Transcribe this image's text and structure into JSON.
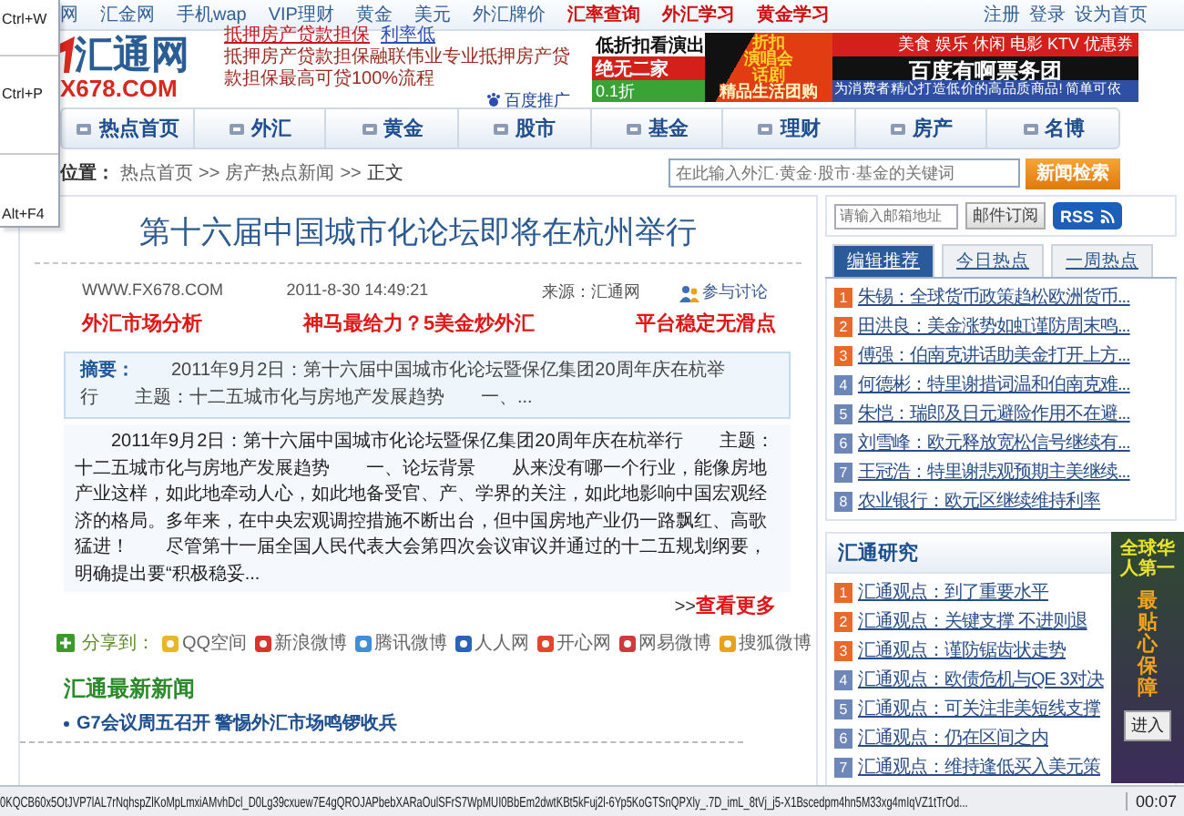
{
  "context_menu": {
    "items": [
      "Ctrl+W",
      "Ctrl+P",
      "Alt+F4"
    ]
  },
  "top_links": [
    {
      "text": "网",
      "kind": "plain"
    },
    {
      "text": "汇金网",
      "kind": "plain"
    },
    {
      "text": "手机wap",
      "kind": "plain"
    },
    {
      "text": "VIP理财",
      "kind": "plain"
    },
    {
      "text": "黄金",
      "kind": "plain"
    },
    {
      "text": "美元",
      "kind": "plain"
    },
    {
      "text": "外汇牌价",
      "kind": "plain"
    },
    {
      "text": "汇率查询",
      "kind": "hot"
    },
    {
      "text": "外汇学习",
      "kind": "hot"
    },
    {
      "text": "黄金学习",
      "kind": "hot"
    }
  ],
  "account_links": [
    "注册",
    "登录",
    "设为首页"
  ],
  "logo": {
    "name": "汇通网",
    "domain": "X678.COM"
  },
  "text_ad": {
    "headline": [
      "抵押房产贷款担保",
      "利率低"
    ],
    "body": "抵押房产贷款担保融联伟业专业抵押房产贷款担保最高可贷100%流程",
    "sponsor": "百度推广"
  },
  "banner_ad": {
    "tagline": "低折扣看演出",
    "badge": "绝无二家",
    "discount": "0.1折",
    "promo": [
      "折扣",
      "演唱会",
      "话剧"
    ],
    "offer": "精品生活团购",
    "categories": "美食 娱乐 休闲 电影 KTV 优惠券",
    "brand": "百度有啊票务团",
    "slogan": "为消费者精心打造低价的高品质商品! 简单可依"
  },
  "nav": [
    {
      "label": "热点首页"
    },
    {
      "label": "外汇"
    },
    {
      "label": "黄金"
    },
    {
      "label": "股市"
    },
    {
      "label": "基金"
    },
    {
      "label": "理财"
    },
    {
      "label": "房产"
    },
    {
      "label": "名博"
    }
  ],
  "breadcrumb": {
    "label": "位置：",
    "items": [
      {
        "kind": "link",
        "text": "热点首页"
      },
      {
        "kind": "sep",
        "text": ">>"
      },
      {
        "kind": "link",
        "text": "房产热点新闻"
      },
      {
        "kind": "sep",
        "text": ">>"
      },
      {
        "kind": "current",
        "text": "正文"
      }
    ]
  },
  "search": {
    "placeholder": "在此输入外汇·黄金·股市·基金的关键词",
    "button": "新闻检索"
  },
  "subscribe": {
    "placeholder": "请输入邮箱地址",
    "button": "邮件订阅",
    "rss": "RSS"
  },
  "article": {
    "title": "第十六届中国城市化论坛即将在杭州举行",
    "site": "WWW.FX678.COM",
    "date": "2011-8-30 14:49:21",
    "source": "来源：汇通网",
    "discuss": "参与讨论",
    "promo_links": [
      "外汇市场分析",
      "神马最给力？5美金炒外汇",
      "平台稳定无滑点"
    ],
    "summary_label": "摘要：",
    "summary": "2011年9月2日：第十六届中国城市化论坛暨保亿集团20周年庆在杭举行　　主题：十二五城市化与房地产发展趋势　　一、...",
    "body": "　　2011年9月2日：第十六届中国城市化论坛暨保亿集团20周年庆在杭举行　　主题：十二五城市化与房地产发展趋势　　一、论坛背景　　从来没有哪一个行业，能像房地产业这样，如此地牵动人心，如此地备受官、产、学界的关注，如此地影响中国宏观经济的格局。多年来，在中央宏观调控措施不断出台，但中国房地产业仍一路飘红、高歌猛进！　　尽管第十一届全国人民代表大会第四次会议审议并通过的十二五规划纲要，明确提出要“积极稳妥...",
    "more_prefix": ">>",
    "more": "查看更多"
  },
  "share": {
    "label": "分享到：",
    "targets": [
      "QQ空间",
      "新浪微博",
      "腾讯微博",
      "人人网",
      "开心网",
      "网易微博",
      "搜狐微博"
    ]
  },
  "latest_news": {
    "title": "汇通最新新闻",
    "items": [
      "G7会议周五召开  警惕外汇市场鸣锣收兵"
    ]
  },
  "tabs": [
    {
      "label": "编辑推荐",
      "selected": true
    },
    {
      "label": "今日热点",
      "selected": false
    },
    {
      "label": "一周热点",
      "selected": false
    }
  ],
  "hot_list": [
    {
      "rank": "1",
      "title": "朱锡：全球货币政策趋松欧洲货币...",
      "color": "#e8692c"
    },
    {
      "rank": "2",
      "title": "田洪良：美金涨势如虹谨防周末鸣...",
      "color": "#e8692c"
    },
    {
      "rank": "3",
      "title": "傅强：伯南克讲话助美金打开上方...",
      "color": "#e8692c"
    },
    {
      "rank": "4",
      "title": "何德彬：特里谢措词温和伯南克难...",
      "color": "#6d87b9"
    },
    {
      "rank": "5",
      "title": "朱恺：瑞郎及日元避险作用不在避...",
      "color": "#6d87b9"
    },
    {
      "rank": "6",
      "title": "刘雪峰：欧元释放宽松信号继续有...",
      "color": "#6d87b9"
    },
    {
      "rank": "7",
      "title": "王冠浩：特里谢悲观预期主美继续...",
      "color": "#6d87b9"
    },
    {
      "rank": "8",
      "title": "农业银行：欧元区继续维持利率",
      "color": "#6d87b9"
    }
  ],
  "research": {
    "title": "汇通研究",
    "items": [
      {
        "rank": "1",
        "title": "汇通观点：到了重要水平",
        "color": "#e8692c"
      },
      {
        "rank": "2",
        "title": "汇通观点：关键支撑 不进则退",
        "color": "#e8692c"
      },
      {
        "rank": "3",
        "title": "汇通观点：谨防锯齿状走势",
        "color": "#e8692c"
      },
      {
        "rank": "4",
        "title": "汇通观点：欧债危机与QE 3对决",
        "color": "#6d87b9"
      },
      {
        "rank": "5",
        "title": "汇通观点：可关注非美短线支撑",
        "color": "#6d87b9"
      },
      {
        "rank": "6",
        "title": "汇通观点：仍在区间之内",
        "color": "#6d87b9"
      },
      {
        "rank": "7",
        "title": "汇通观点：维持逢低买入美元策",
        "color": "#6d87b9"
      }
    ]
  },
  "float_ad": {
    "headline": "全球华人第一",
    "slogan": "最贴心保障",
    "button": "进入"
  },
  "status_bar": {
    "url": "0KQCB60x5OtJVP7lAL7rNqhspZlKoMpLmxiAMvhDcl_D0Lg39cxuew7E4gQROJAPbebXARaOulSFrS7WpMUI0BbEm2dwtKBt5kFuj2l-6Yp5KoGTSnQPXly_.7D_imL_8tVj_j5-X1Bscedpm4hn5M33xg4mIqVZ1tTrOd...",
    "time": "00:07"
  }
}
